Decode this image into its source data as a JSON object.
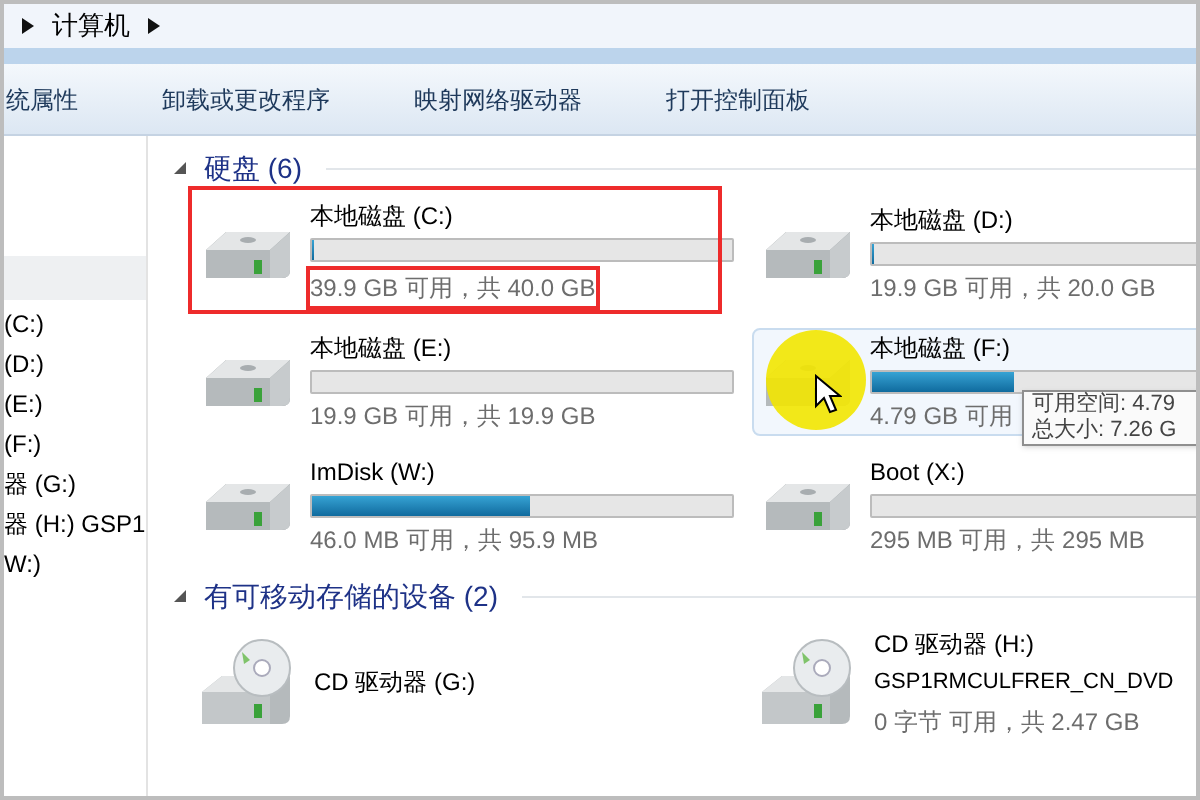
{
  "address_bar": {
    "path": [
      "计算机"
    ]
  },
  "toolbar": [
    "统属性",
    "卸载或更改程序",
    "映射网络驱动器",
    "打开控制面板"
  ],
  "navigation": [
    "(C:)",
    "(D:)",
    "(E:)",
    "(F:)",
    "器 (G:)",
    "器 (H:) GSP1",
    "W:)"
  ],
  "groups": [
    {
      "title": "硬盘 (6)",
      "expanded": true,
      "items": [
        {
          "kind": "disk",
          "name": "本地磁盘 (C:)",
          "level": 0.0025,
          "free": "39.9 GB 可用，共 40.0 GB",
          "highlight": true,
          "free_highlight": true,
          "hovered": false
        },
        {
          "kind": "disk",
          "name": "本地磁盘 (D:)",
          "level": 0.005,
          "free": "19.9 GB 可用，共 20.0 GB",
          "hovered": false
        },
        {
          "kind": "disk",
          "name": "本地磁盘 (E:)",
          "level": 0,
          "free": "19.9 GB 可用，共 19.9 GB",
          "hovered": false
        },
        {
          "kind": "disk",
          "name": "本地磁盘 (F:)",
          "level": 0.34,
          "free": "4.79 GB 可用",
          "hovered": true,
          "tooltip": [
            "可用空间: 4.79",
            "总大小: 7.26 G"
          ]
        },
        {
          "kind": "disk",
          "name": "ImDisk (W:)",
          "level": 0.52,
          "free": "46.0 MB 可用，共 95.9 MB",
          "hovered": false
        },
        {
          "kind": "disk",
          "name": "Boot (X:)",
          "level": 0,
          "free": "295 MB 可用，共 295 MB",
          "hovered": false
        }
      ]
    },
    {
      "title": "有可移动存储的设备 (2)",
      "expanded": true,
      "items": [
        {
          "kind": "cd",
          "name": "CD 驱动器 (G:)"
        },
        {
          "kind": "cd",
          "name": "CD 驱动器 (H:)",
          "label": "GSP1RMCULFRER_CN_DVD",
          "free": "0 字节 可用，共 2.47 GB"
        }
      ]
    }
  ]
}
